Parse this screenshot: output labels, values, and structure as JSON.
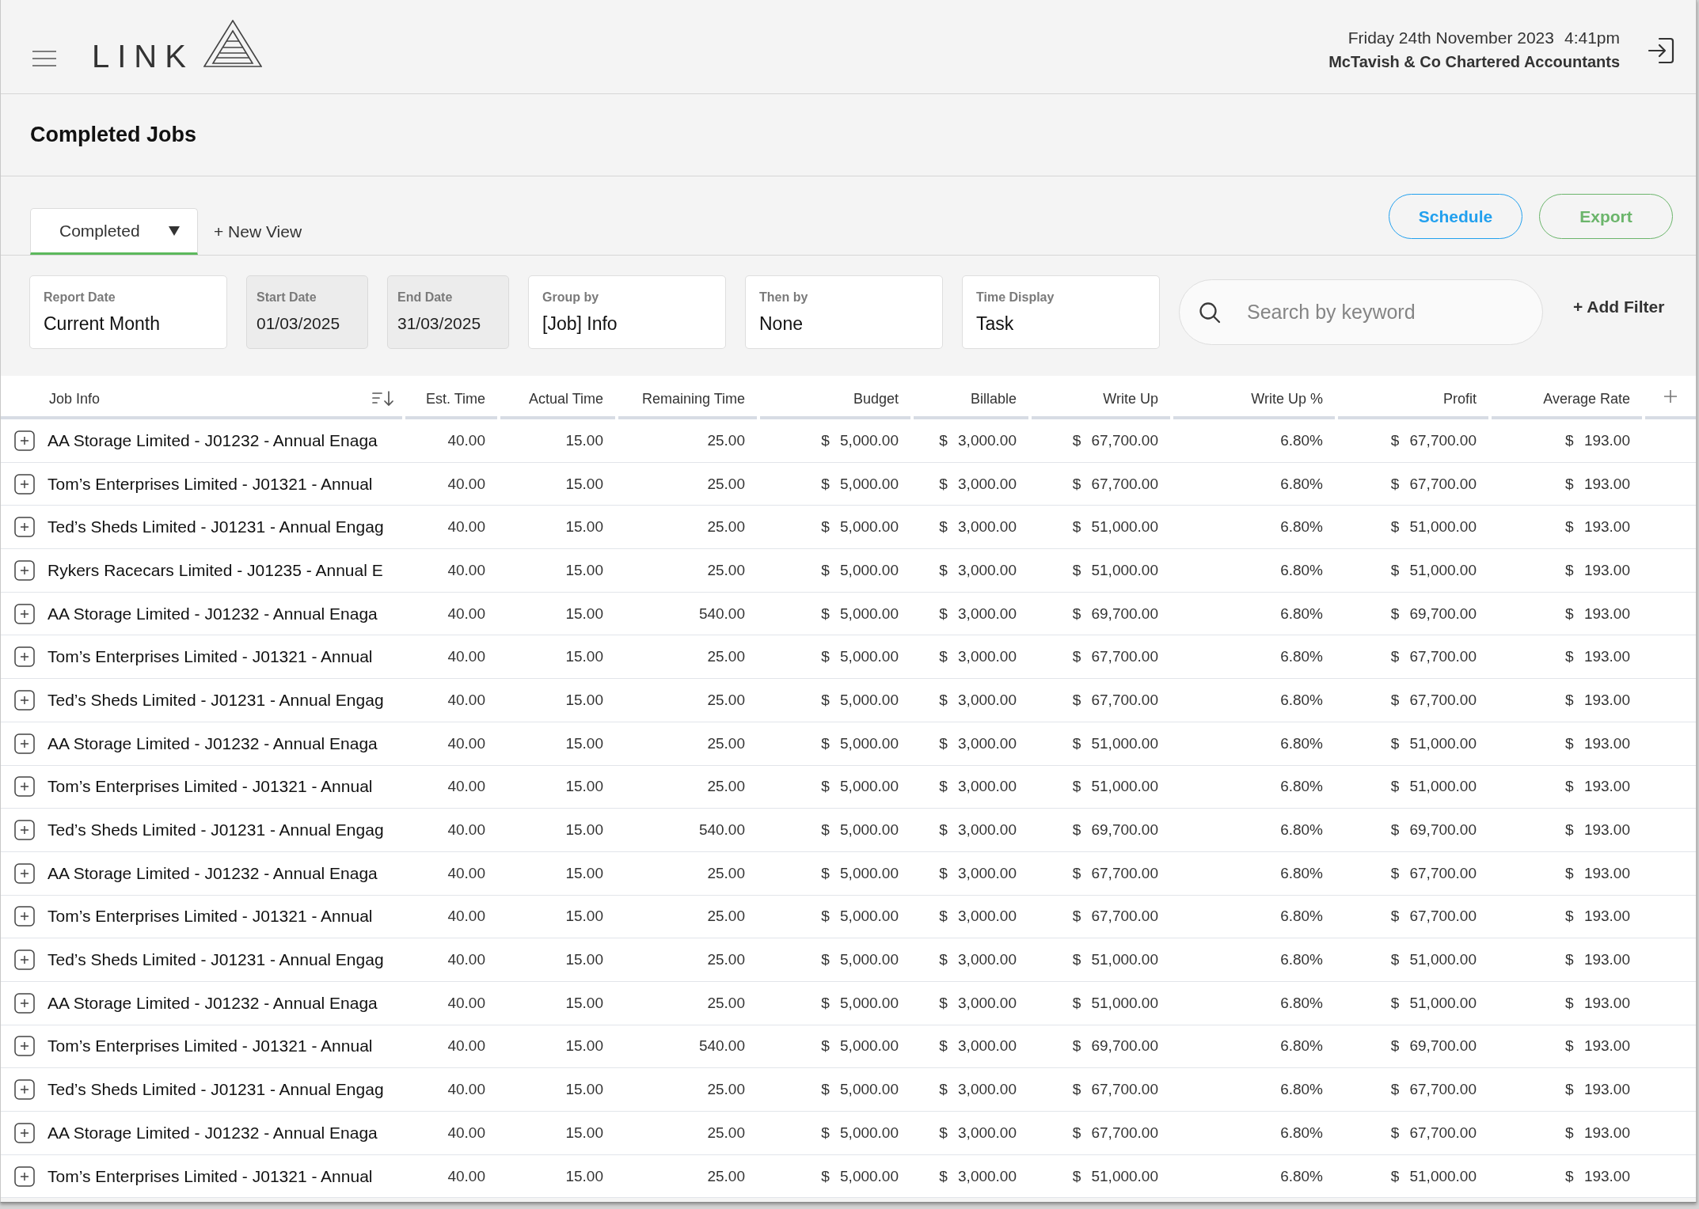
{
  "header": {
    "logo": "LINK",
    "date": "Friday 24th November 2023",
    "time": "4:41pm",
    "organisation": "McTavish & Co Chartered Accountants"
  },
  "page_title": "Completed Jobs",
  "view_tabs": [
    {
      "label": "Completed",
      "selected": true
    }
  ],
  "new_view": "+ New View",
  "actions": [
    {
      "label": "Schedule",
      "color": "#22a0ee"
    },
    {
      "label": "Export",
      "color": "#6bb56b"
    }
  ],
  "filters": [
    {
      "label": "Report Date",
      "value": "Current Month",
      "disabled": false
    },
    {
      "label": "Start Date",
      "value": "01/03/2025",
      "disabled": true
    },
    {
      "label": "End Date",
      "value": "31/03/2025",
      "disabled": true
    },
    {
      "label": "Group by",
      "value": "[Job] Info",
      "disabled": false
    },
    {
      "label": "Then by",
      "value": "None",
      "disabled": false
    },
    {
      "label": "Time Display",
      "value": "Task",
      "disabled": false
    }
  ],
  "search": {
    "placeholder": "Search by keyword"
  },
  "add_filter": "+ Add Filter",
  "table": {
    "columns": [
      {
        "label": "Job Info",
        "sorted": true
      },
      {
        "label": "Est. Time",
        "sorted": false
      },
      {
        "label": "Actual Time",
        "sorted": false
      },
      {
        "label": "Remaining Time",
        "sorted": false
      },
      {
        "label": "Budget",
        "sorted": false
      },
      {
        "label": "Billable",
        "sorted": false
      },
      {
        "label": "Write Up",
        "sorted": false
      },
      {
        "label": "Write Up %",
        "sorted": false
      },
      {
        "label": "Profit",
        "sorted": false
      },
      {
        "label": "Average Rate",
        "sorted": false
      }
    ],
    "rows": [
      {
        "expanded": false,
        "cells": [
          "AA Storage Limited - J01232 - Annual Enaga",
          "40.00",
          "15.00",
          "25.00",
          "$ 5,000.00",
          "$ 3,000.00",
          "$ 67,700.00",
          "6.80%",
          "$ 67,700.00",
          "$ 193.00"
        ]
      },
      {
        "expanded": false,
        "cells": [
          "Tom’s Enterprises Limited - J01321 - Annual",
          "40.00",
          "15.00",
          "25.00",
          "$ 5,000.00",
          "$ 3,000.00",
          "$ 67,700.00",
          "6.80%",
          "$ 67,700.00",
          "$ 193.00"
        ]
      },
      {
        "expanded": false,
        "cells": [
          "Ted’s Sheds Limited - J01231 - Annual Engag",
          "40.00",
          "15.00",
          "25.00",
          "$ 5,000.00",
          "$ 3,000.00",
          "$ 51,000.00",
          "6.80%",
          "$ 51,000.00",
          "$ 193.00"
        ]
      },
      {
        "expanded": false,
        "cells": [
          "Rykers Racecars Limited - J01235 - Annual E",
          "40.00",
          "15.00",
          "25.00",
          "$ 5,000.00",
          "$ 3,000.00",
          "$ 51,000.00",
          "6.80%",
          "$ 51,000.00",
          "$ 193.00"
        ]
      },
      {
        "expanded": false,
        "cells": [
          "AA Storage Limited - J01232 - Annual Enaga",
          "40.00",
          "15.00",
          "540.00",
          "$ 5,000.00",
          "$ 3,000.00",
          "$ 69,700.00",
          "6.80%",
          "$ 69,700.00",
          "$ 193.00"
        ]
      },
      {
        "expanded": false,
        "cells": [
          "Tom’s Enterprises Limited - J01321 - Annual",
          "40.00",
          "15.00",
          "25.00",
          "$ 5,000.00",
          "$ 3,000.00",
          "$ 67,700.00",
          "6.80%",
          "$ 67,700.00",
          "$ 193.00"
        ]
      },
      {
        "expanded": false,
        "cells": [
          "Ted’s Sheds Limited - J01231 - Annual Engag",
          "40.00",
          "15.00",
          "25.00",
          "$ 5,000.00",
          "$ 3,000.00",
          "$ 67,700.00",
          "6.80%",
          "$ 67,700.00",
          "$ 193.00"
        ]
      },
      {
        "expanded": false,
        "cells": [
          "AA Storage Limited - J01232 - Annual Enaga",
          "40.00",
          "15.00",
          "25.00",
          "$ 5,000.00",
          "$ 3,000.00",
          "$ 51,000.00",
          "6.80%",
          "$ 51,000.00",
          "$ 193.00"
        ]
      },
      {
        "expanded": false,
        "cells": [
          "Tom’s Enterprises Limited - J01321 - Annual",
          "40.00",
          "15.00",
          "25.00",
          "$ 5,000.00",
          "$ 3,000.00",
          "$ 51,000.00",
          "6.80%",
          "$ 51,000.00",
          "$ 193.00"
        ]
      },
      {
        "expanded": false,
        "cells": [
          "Ted’s Sheds Limited - J01231 - Annual Engag",
          "40.00",
          "15.00",
          "540.00",
          "$ 5,000.00",
          "$ 3,000.00",
          "$ 69,700.00",
          "6.80%",
          "$ 69,700.00",
          "$ 193.00"
        ]
      },
      {
        "expanded": false,
        "cells": [
          "AA Storage Limited - J01232 - Annual Enaga",
          "40.00",
          "15.00",
          "25.00",
          "$ 5,000.00",
          "$ 3,000.00",
          "$ 67,700.00",
          "6.80%",
          "$ 67,700.00",
          "$ 193.00"
        ]
      },
      {
        "expanded": false,
        "cells": [
          "Tom’s Enterprises Limited - J01321 - Annual",
          "40.00",
          "15.00",
          "25.00",
          "$ 5,000.00",
          "$ 3,000.00",
          "$ 67,700.00",
          "6.80%",
          "$ 67,700.00",
          "$ 193.00"
        ]
      },
      {
        "expanded": false,
        "cells": [
          "Ted’s Sheds Limited - J01231 - Annual Engag",
          "40.00",
          "15.00",
          "25.00",
          "$ 5,000.00",
          "$ 3,000.00",
          "$ 51,000.00",
          "6.80%",
          "$ 51,000.00",
          "$ 193.00"
        ]
      },
      {
        "expanded": false,
        "cells": [
          "AA Storage Limited - J01232 - Annual Enaga",
          "40.00",
          "15.00",
          "25.00",
          "$ 5,000.00",
          "$ 3,000.00",
          "$ 51,000.00",
          "6.80%",
          "$ 51,000.00",
          "$ 193.00"
        ]
      },
      {
        "expanded": false,
        "cells": [
          "Tom’s Enterprises Limited - J01321 - Annual",
          "40.00",
          "15.00",
          "540.00",
          "$ 5,000.00",
          "$ 3,000.00",
          "$ 69,700.00",
          "6.80%",
          "$ 69,700.00",
          "$ 193.00"
        ]
      },
      {
        "expanded": false,
        "cells": [
          "Ted’s Sheds Limited - J01231 - Annual Engag",
          "40.00",
          "15.00",
          "25.00",
          "$ 5,000.00",
          "$ 3,000.00",
          "$ 67,700.00",
          "6.80%",
          "$ 67,700.00",
          "$ 193.00"
        ]
      },
      {
        "expanded": false,
        "cells": [
          "AA Storage Limited - J01232 - Annual Enaga",
          "40.00",
          "15.00",
          "25.00",
          "$ 5,000.00",
          "$ 3,000.00",
          "$ 67,700.00",
          "6.80%",
          "$ 67,700.00",
          "$ 193.00"
        ]
      },
      {
        "expanded": false,
        "cells": [
          "Tom’s Enterprises Limited - J01321 - Annual",
          "40.00",
          "15.00",
          "25.00",
          "$ 5,000.00",
          "$ 3,000.00",
          "$ 51,000.00",
          "6.80%",
          "$ 51,000.00",
          "$ 193.00"
        ]
      }
    ]
  }
}
